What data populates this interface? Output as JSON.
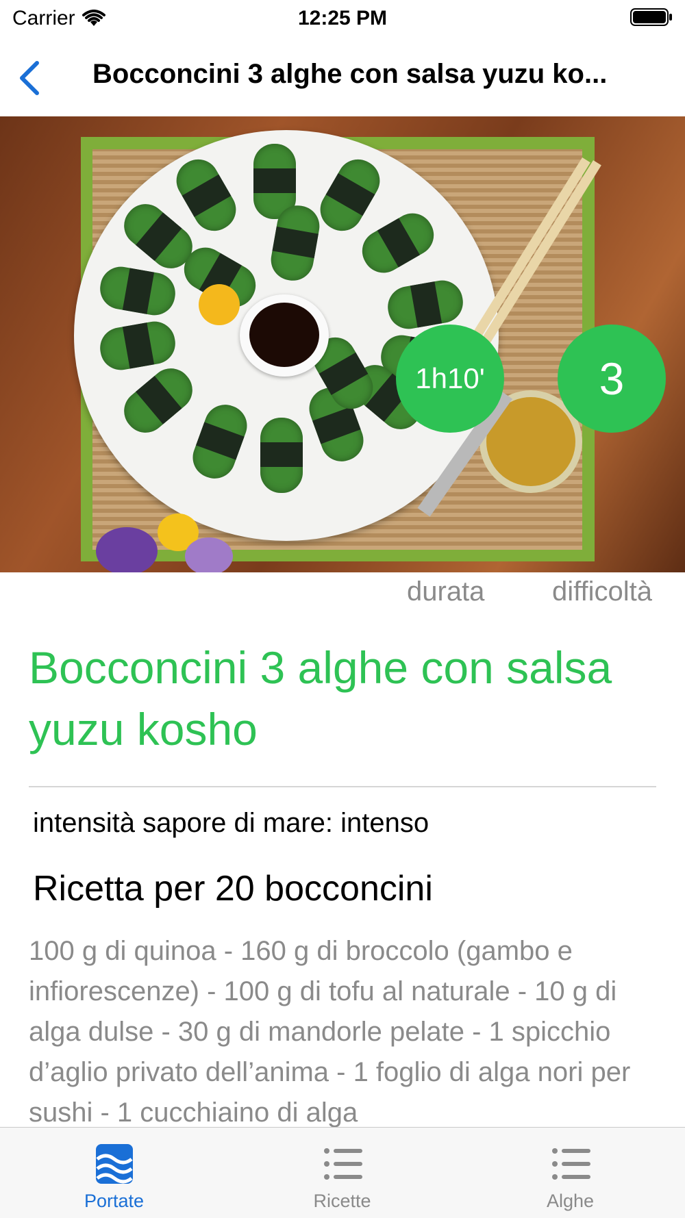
{
  "status_bar": {
    "carrier": "Carrier",
    "time": "12:25 PM"
  },
  "nav": {
    "title": "Bocconcini 3 alghe con salsa yuzu ko..."
  },
  "badges": {
    "duration_value": "1h10'",
    "duration_label": "durata",
    "difficulty_value": "3",
    "difficulty_label": "difficoltà"
  },
  "recipe": {
    "title": "Bocconcini 3 alghe con salsa yuzu kosho",
    "intensity": "intensità sapore di mare: intenso",
    "servings": "Ricetta per 20 bocconcini",
    "ingredients": "100 g di quinoa - 160 g di broccolo (gambo e infiorescenze) - 100 g di tofu al naturale - 10 g di alga dulse - 30 g di mandorle pelate - 1 spicchio d’aglio privato dell’anima - 1 foglio di alga nori per sushi - 1 cucchiaino di alga"
  },
  "tabs": [
    {
      "label": "Portate",
      "icon": "waves-icon",
      "active": true
    },
    {
      "label": "Ricette",
      "icon": "list-icon",
      "active": false
    },
    {
      "label": "Alghe",
      "icon": "list-icon",
      "active": false
    }
  ],
  "colors": {
    "accent_green": "#2ec254",
    "tint_blue": "#1a6fd6"
  }
}
